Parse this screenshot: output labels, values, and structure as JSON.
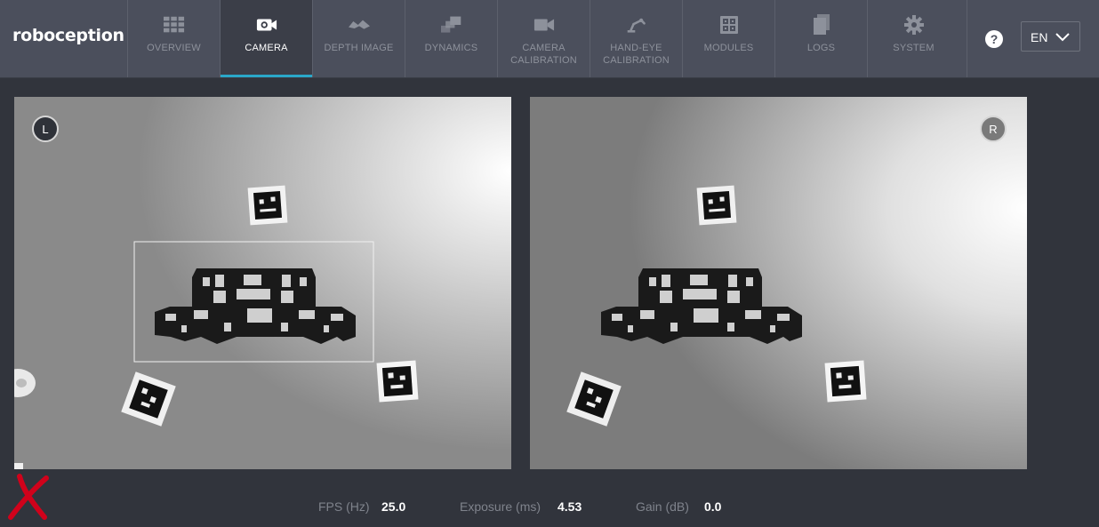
{
  "header": {
    "brand": "roboception",
    "nav": [
      {
        "label": "OVERVIEW",
        "icon": "grid-icon"
      },
      {
        "label": "CAMERA",
        "icon": "camera-icon",
        "active": true
      },
      {
        "label": "DEPTH IMAGE",
        "icon": "depth-image-icon"
      },
      {
        "label": "DYNAMICS",
        "icon": "dynamics-icon"
      },
      {
        "label": "CAMERA CALIBRATION",
        "icon": "video-camera-icon"
      },
      {
        "label": "HAND-EYE CALIBRATION",
        "icon": "robot-arm-icon"
      },
      {
        "label": "MODULES",
        "icon": "modules-icon"
      },
      {
        "label": "LOGS",
        "icon": "logs-icon"
      },
      {
        "label": "SYSTEM",
        "icon": "gear-icon"
      }
    ],
    "help": "?",
    "language": "EN"
  },
  "cameras": {
    "left": {
      "badge": "L"
    },
    "right": {
      "badge": "R"
    }
  },
  "stats": {
    "fps_label": "FPS (Hz)",
    "fps_value": "25.0",
    "exposure_label": "Exposure (ms)",
    "exposure_value": "4.53",
    "gain_label": "Gain (dB)",
    "gain_value": "0.0"
  },
  "colors": {
    "accent": "#2aa7c9",
    "header_bg": "#4b4f5c",
    "page_bg": "#31343c",
    "error": "#d0021b"
  }
}
